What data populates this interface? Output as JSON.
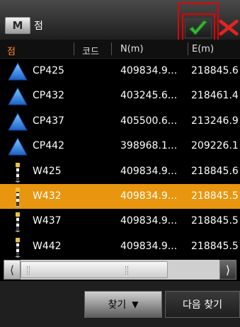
{
  "window": {
    "menu_label": "M",
    "title": "점",
    "ok_icon": "checkmark-icon",
    "close_icon": "close-x-icon",
    "accent_color": "#e8960f"
  },
  "columns": [
    {
      "label": "점"
    },
    {
      "label": "코드"
    },
    {
      "label": "N(m)"
    },
    {
      "label": "E(m)"
    }
  ],
  "rows": [
    {
      "icon": "control-point-triangle-icon",
      "name": "CP425",
      "code": "",
      "n": "409834.9...",
      "e": "218845.6",
      "selected": false
    },
    {
      "icon": "control-point-triangle-icon",
      "name": "CP432",
      "code": "",
      "n": "403245.6...",
      "e": "218461.4",
      "selected": false
    },
    {
      "icon": "control-point-triangle-icon",
      "name": "CP437",
      "code": "",
      "n": "405500.6...",
      "e": "213246.9",
      "selected": false
    },
    {
      "icon": "control-point-triangle-icon",
      "name": "CP442",
      "code": "",
      "n": "398968.1...",
      "e": "209226.1",
      "selected": false
    },
    {
      "icon": "survey-pole-icon",
      "name": "W425",
      "code": "",
      "n": "409834.9...",
      "e": "218845.6",
      "selected": false
    },
    {
      "icon": "survey-pole-icon",
      "name": "W432",
      "code": "",
      "n": "409834.9...",
      "e": "218845.5",
      "selected": true
    },
    {
      "icon": "survey-pole-icon",
      "name": "W437",
      "code": "",
      "n": "409834.9...",
      "e": "218845.5",
      "selected": false
    },
    {
      "icon": "survey-pole-icon",
      "name": "W442",
      "code": "",
      "n": "409834.9...",
      "e": "218845.5",
      "selected": false
    }
  ],
  "scrollbar": {
    "left_label": "⟨",
    "right_label": "⟩"
  },
  "footer": {
    "find_label": "찾기",
    "find_dropdown": "▼",
    "next_label": "다음 찾기"
  }
}
